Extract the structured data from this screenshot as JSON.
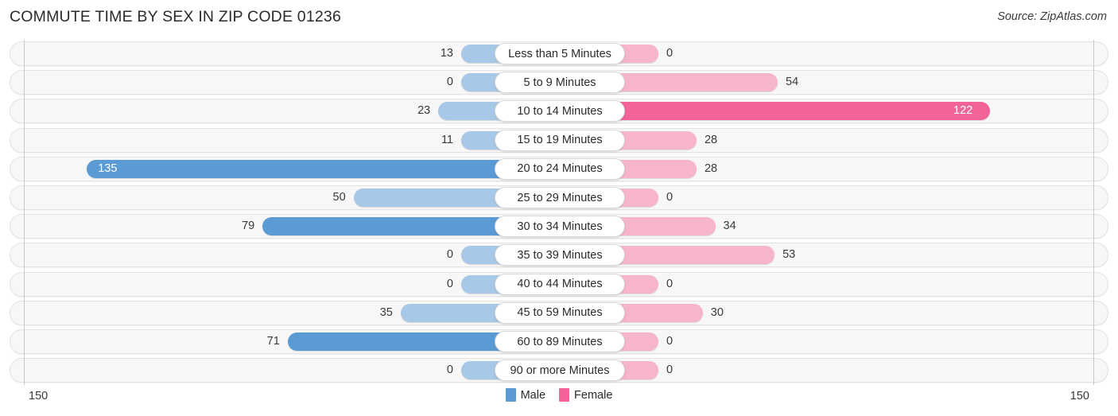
{
  "header": {
    "title": "COMMUTE TIME BY SEX IN ZIP CODE 01236",
    "source": "Source: ZipAtlas.com"
  },
  "legend": {
    "male_label": "Male",
    "female_label": "Female",
    "male_color": "#5b9bd5",
    "female_color": "#f2639a"
  },
  "axis": {
    "left_end": "150",
    "right_end": "150",
    "max": 150
  },
  "colors": {
    "male_light": "#a8c8e8",
    "male_strong": "#5b9bd5",
    "female_light": "#f7b4cd",
    "female_strong": "#f2639a",
    "track": "#f7f7f7"
  },
  "chart_data": {
    "type": "bar",
    "title": "COMMUTE TIME BY SEX IN ZIP CODE 01236",
    "subtype": "diverging-horizontal-bar",
    "xlabel": "",
    "ylabel": "",
    "xlim": [
      150,
      150
    ],
    "grid": false,
    "legend_position": "bottom-center",
    "categories": [
      "Less than 5 Minutes",
      "5 to 9 Minutes",
      "10 to 14 Minutes",
      "15 to 19 Minutes",
      "20 to 24 Minutes",
      "25 to 29 Minutes",
      "30 to 34 Minutes",
      "35 to 39 Minutes",
      "40 to 44 Minutes",
      "45 to 59 Minutes",
      "60 to 89 Minutes",
      "90 or more Minutes"
    ],
    "series": [
      {
        "name": "Male",
        "direction": "left",
        "values": [
          13,
          0,
          23,
          11,
          135,
          50,
          79,
          0,
          0,
          35,
          71,
          0
        ]
      },
      {
        "name": "Female",
        "direction": "right",
        "values": [
          0,
          54,
          122,
          28,
          28,
          0,
          34,
          53,
          0,
          30,
          0,
          0
        ]
      }
    ]
  }
}
